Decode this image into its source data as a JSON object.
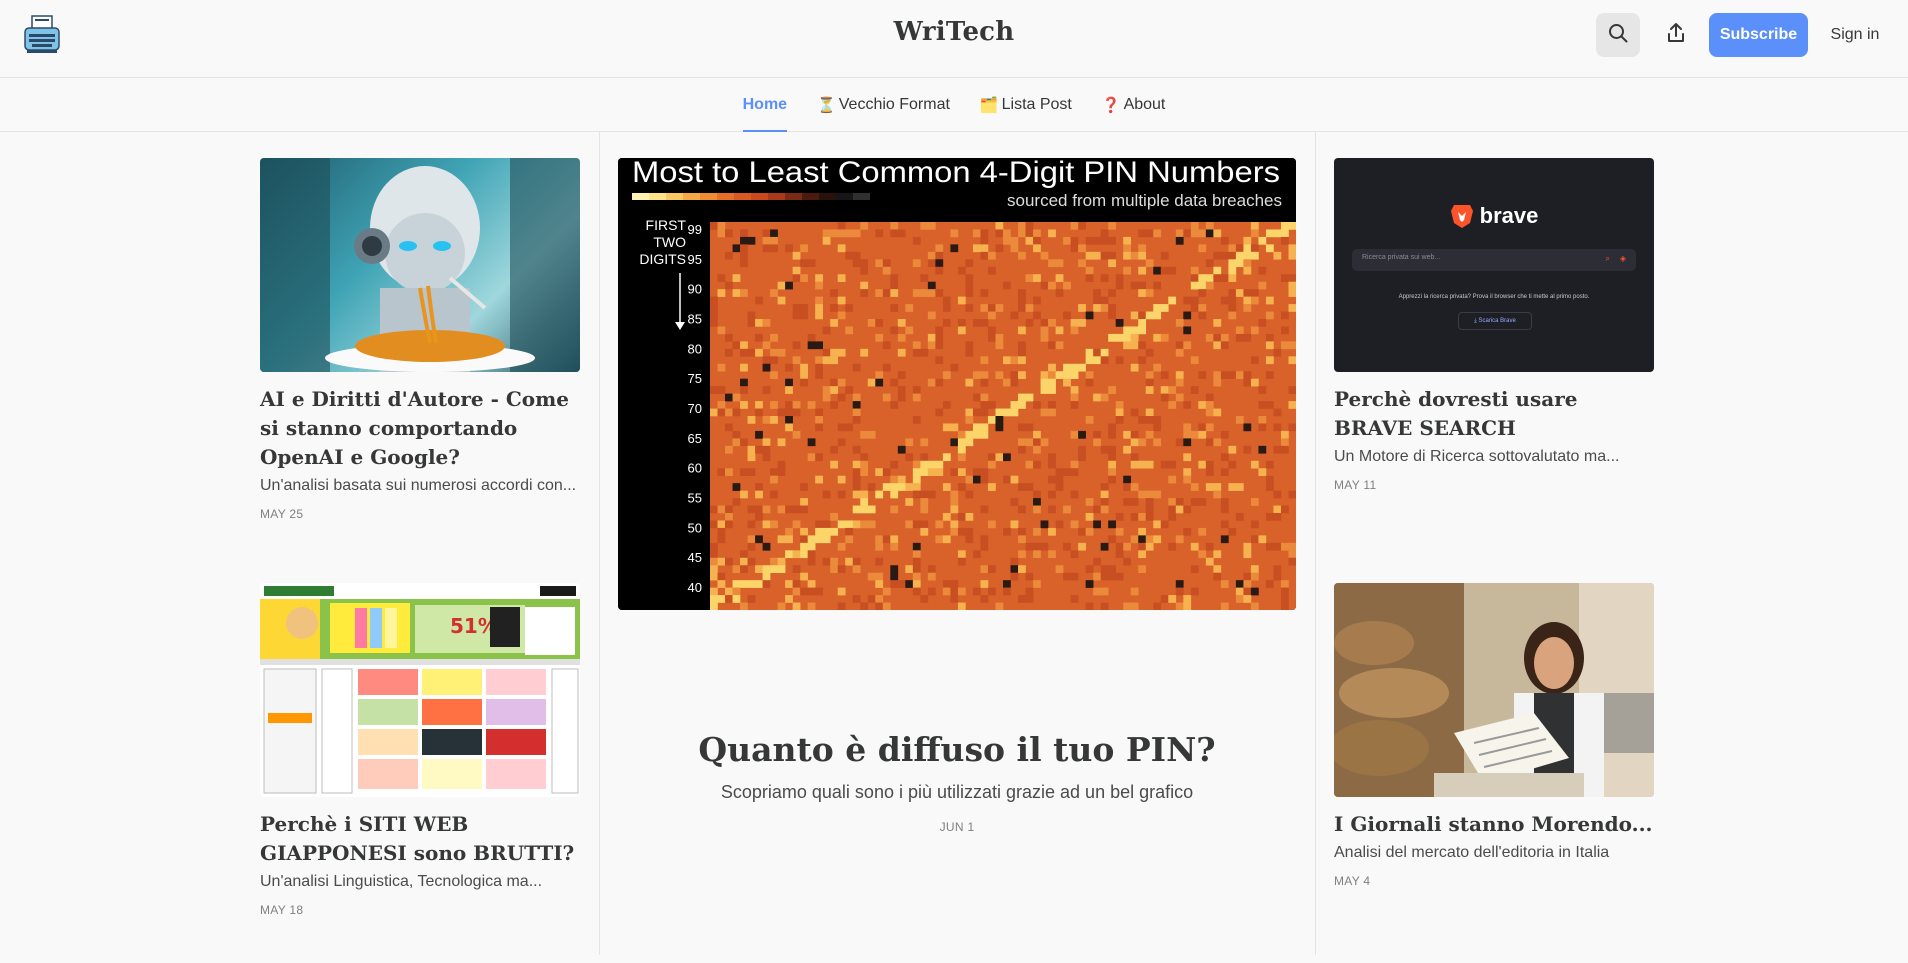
{
  "header": {
    "title": "WriTech",
    "logo_icon": "typewriter-icon",
    "search_icon": "search-icon",
    "share_icon": "share-icon",
    "subscribe_label": "Subscribe",
    "signin_label": "Sign in",
    "accent_color": "#5b8ff9"
  },
  "nav": {
    "items": [
      {
        "emoji": "",
        "label": "Home",
        "active": true
      },
      {
        "emoji": "⏳",
        "label": "Vecchio Format",
        "active": false
      },
      {
        "emoji": "🗂️",
        "label": "Lista Post",
        "active": false
      },
      {
        "emoji": "❓",
        "label": "About",
        "active": false
      }
    ]
  },
  "hero": {
    "image": {
      "heading": "Most to Least Common 4-Digit PIN Numbers",
      "subheading": "sourced from multiple data breaches",
      "axis_title": "FIRST\nTWO\nDIGITS",
      "y_ticks": [
        "99",
        "95",
        "90",
        "85",
        "80",
        "75",
        "70",
        "65",
        "60",
        "55",
        "50",
        "45",
        "40"
      ]
    },
    "title": "Quanto è diffuso il tuo PIN?",
    "subtitle": "Scopriamo quali sono i più utilizzati grazie ad un bel grafico",
    "date": "JUN 1"
  },
  "posts": [
    {
      "title": "AI e Diritti d'Autore - Come si stanno comportando OpenAI e Google?",
      "subtitle": "Un'analisi basata sui numerosi accordi con...",
      "date": "MAY 25"
    },
    {
      "title": "Perchè i SITI WEB GIAPPONESI sono BRUTTI?",
      "subtitle": "Un'analisi Linguistica, Tecnologica ma...",
      "date": "MAY 18"
    },
    {
      "title": "Perchè dovresti usare BRAVE SEARCH",
      "subtitle": "Un Motore di Ricerca sottovalutato ma...",
      "date": "MAY 11",
      "image": {
        "brand": "brave",
        "search_placeholder": "Ricerca privata sui web...",
        "tagline": "Apprezzi la ricerca privata? Prova il browser che ti mette al primo posto.",
        "cta": "Scarica Brave"
      }
    },
    {
      "title": "I Giornali stanno Morendo...",
      "subtitle": "Analisi del mercato dell'editoria in Italia",
      "date": "MAY 4"
    }
  ]
}
